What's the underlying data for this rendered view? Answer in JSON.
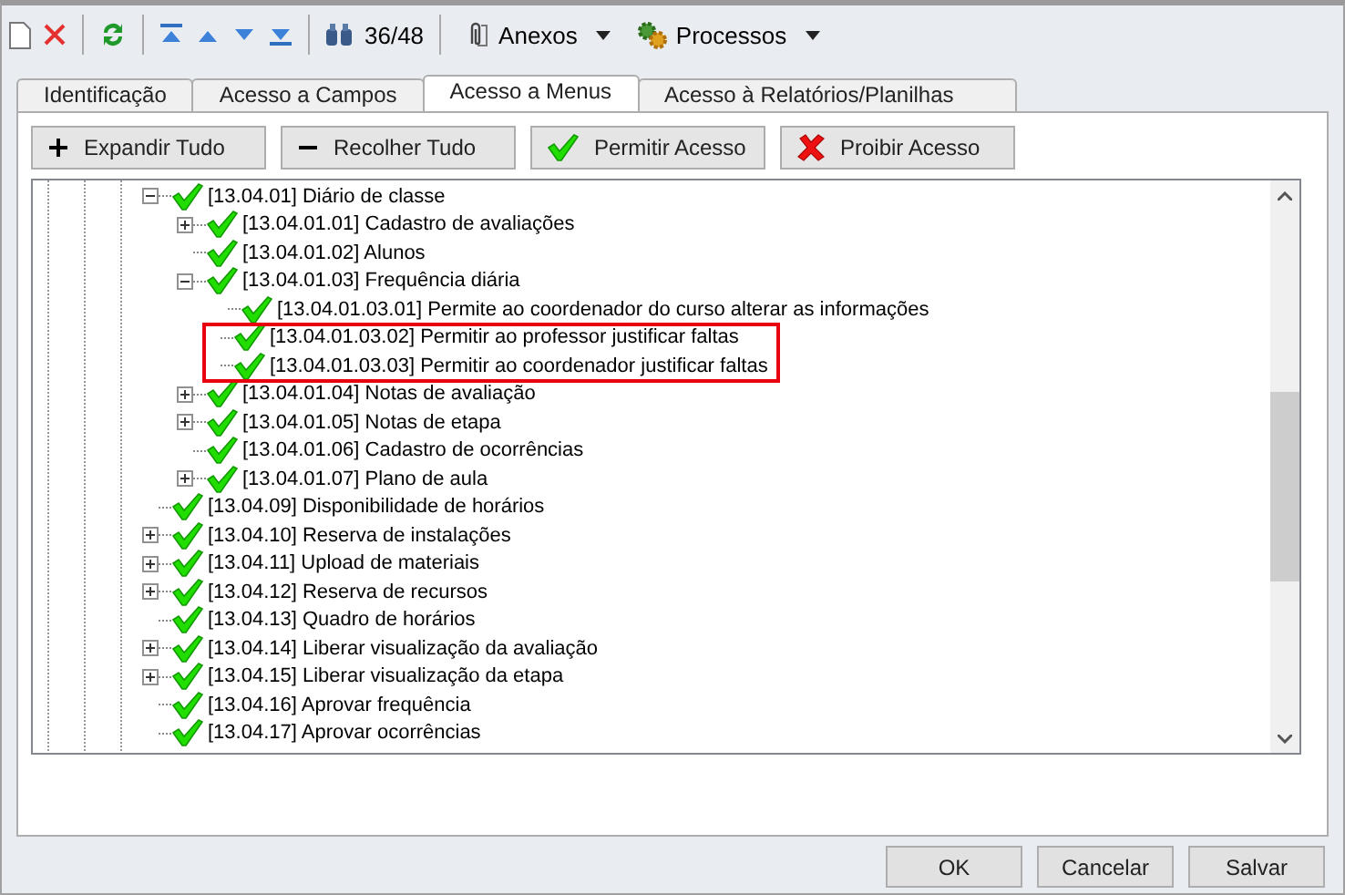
{
  "toolbar": {
    "counter": "36/48",
    "menus": [
      {
        "label": "Anexos",
        "kind": "attach"
      },
      {
        "label": "Processos",
        "kind": "process"
      }
    ]
  },
  "tabs": [
    {
      "label": "Identificação",
      "selected": false
    },
    {
      "label": "Acesso a Campos",
      "selected": false
    },
    {
      "label": "Acesso a Menus",
      "selected": true
    },
    {
      "label": "Acesso à Relatórios/Planilhas",
      "selected": false
    }
  ],
  "actions": [
    {
      "kind": "expand",
      "label": "Expandir Tudo"
    },
    {
      "kind": "collapse",
      "label": "Recolher Tudo"
    },
    {
      "kind": "allow",
      "label": "Permitir Acesso"
    },
    {
      "kind": "deny",
      "label": "Proibir Acesso"
    }
  ],
  "tree": [
    {
      "label": "[13.04.01] Diário de classe",
      "allowed": true,
      "expanded": true,
      "children": [
        {
          "label": "[13.04.01.01] Cadastro de avaliações",
          "allowed": true,
          "expanded": false
        },
        {
          "label": "[13.04.01.02] Alunos",
          "allowed": true
        },
        {
          "label": "[13.04.01.03] Frequência diária",
          "allowed": true,
          "expanded": true,
          "children": [
            {
              "label": "[13.04.01.03.01] Permite ao coordenador do curso alterar as informações",
              "allowed": true,
              "highlighted": false
            },
            {
              "label": "[13.04.01.03.02] Permitir ao professor justificar faltas",
              "allowed": true,
              "highlighted": true
            },
            {
              "label": "[13.04.01.03.03] Permitir ao coordenador justificar faltas",
              "allowed": true,
              "highlighted": true
            }
          ]
        },
        {
          "label": "[13.04.01.04] Notas de avaliação",
          "allowed": true,
          "expanded": false
        },
        {
          "label": "[13.04.01.05] Notas de etapa",
          "allowed": true,
          "expanded": false
        },
        {
          "label": "[13.04.01.06] Cadastro de ocorrências",
          "allowed": true
        },
        {
          "label": "[13.04.01.07] Plano de aula",
          "allowed": true,
          "expanded": false
        }
      ]
    },
    {
      "label": "[13.04.09] Disponibilidade de horários",
      "allowed": true
    },
    {
      "label": "[13.04.10] Reserva de instalações",
      "allowed": true,
      "expanded": false
    },
    {
      "label": "[13.04.11] Upload de materiais",
      "allowed": true,
      "expanded": false
    },
    {
      "label": "[13.04.12] Reserva de recursos",
      "allowed": true,
      "expanded": false
    },
    {
      "label": "[13.04.13] Quadro de horários",
      "allowed": true
    },
    {
      "label": "[13.04.14] Liberar visualização da avaliação",
      "allowed": true,
      "expanded": false
    },
    {
      "label": "[13.04.15] Liberar visualização da etapa",
      "allowed": true,
      "expanded": false
    },
    {
      "label": "[13.04.16] Aprovar frequência",
      "allowed": true
    },
    {
      "label": "[13.04.17] Aprovar ocorrências",
      "allowed": true
    }
  ],
  "buttons": [
    "OK",
    "Cancelar",
    "Salvar"
  ]
}
